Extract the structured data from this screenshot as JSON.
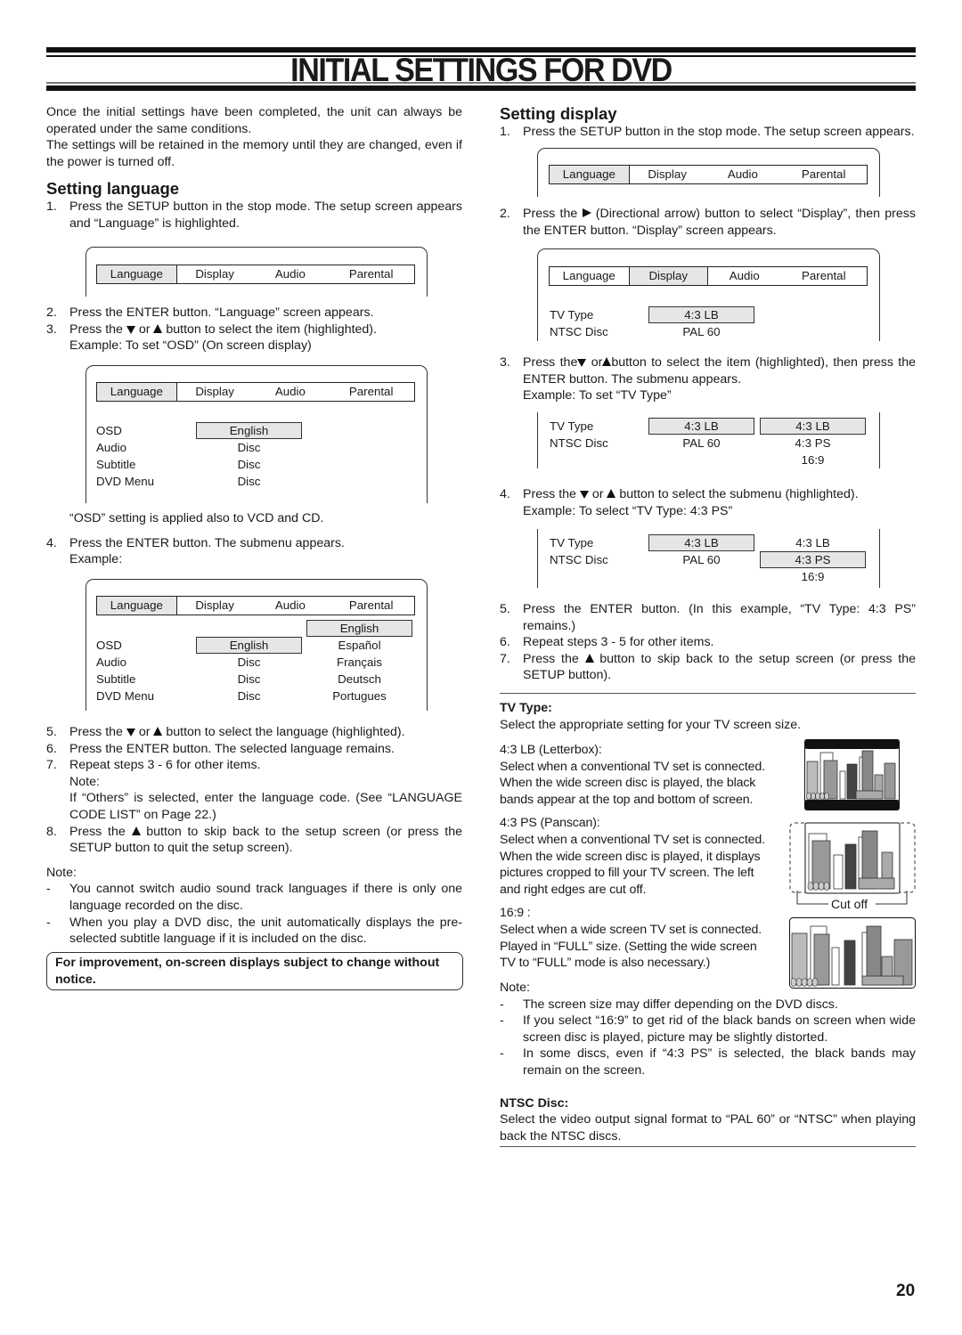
{
  "header": {
    "title": "INITIAL SETTINGS FOR DVD"
  },
  "left": {
    "intro": [
      "Once the initial settings have been completed, the unit can always be operated under the same conditions.",
      "The settings will be retained in the memory until they are changed, even if the power is turned off."
    ],
    "heading": "Setting language",
    "step1": {
      "num": "1.",
      "text": "Press the SETUP button in the stop mode. The setup screen appears and “Language” is highlighted."
    },
    "step2": {
      "num": "2.",
      "text": "Press the ENTER button. “Language” screen appears."
    },
    "step3": {
      "num": "3.",
      "pre": "Press the",
      "mid": "or",
      "post": "button to select the item (highlighted).",
      "example": "Example: To set “OSD” (On screen display)"
    },
    "osd_note": "“OSD” setting is applied also to VCD and CD.",
    "step4": {
      "num": "4.",
      "text": "Press the ENTER button. The submenu appears.",
      "example": "Example:"
    },
    "step5": {
      "num": "5.",
      "pre": "Press the",
      "mid": "or",
      "post": "button to select the language (highlighted)."
    },
    "step6": {
      "num": "6.",
      "text": "Press the ENTER button. The selected language remains."
    },
    "step7": {
      "num": "7.",
      "text": "Repeat steps 3 - 6 for other items.",
      "note_label": "Note:",
      "note_text": "If “Others” is selected, enter the language code. (See “LANGUAGE CODE LIST” on Page 22.)"
    },
    "step8": {
      "num": "8.",
      "pre": "Press the",
      "post": "button to skip back to the setup screen (or press the SETUP button to quit the setup screen)."
    },
    "note_label": "Note:",
    "notes": [
      "You cannot switch audio sound track languages if there is only one language recorded on the disc.",
      "When you play a DVD disc, the unit automatically displays the pre-selected subtitle language if it is included on the disc."
    ],
    "dash": "-",
    "improvement_notice": "For improvement, on-screen displays subject to change without notice."
  },
  "menu": {
    "tabs": [
      "Language",
      "Display",
      "Audio",
      "Parental"
    ],
    "language_items": [
      "OSD",
      "Audio",
      "Subtitle",
      "DVD Menu"
    ],
    "language_values": [
      "English",
      "Disc",
      "Disc",
      "Disc"
    ],
    "language_submenu": [
      "English",
      "Español",
      "Français",
      "Deutsch",
      "Portugues"
    ],
    "display_items": [
      "TV Type",
      "NTSC Disc"
    ],
    "display_values": [
      "4:3 LB",
      "PAL 60"
    ],
    "tv_type_submenu": [
      "4:3 LB",
      "4:3 PS",
      "16:9"
    ]
  },
  "right": {
    "heading": "Setting display",
    "step1": {
      "num": "1.",
      "text": "Press the SETUP button in the stop mode. The setup screen appears."
    },
    "step2": {
      "num": "2.",
      "pre": "Press the",
      "post": "(Directional arrow) button to select “Display”, then press the ENTER button. “Display” screen appears."
    },
    "step3": {
      "num": "3.",
      "pre": "Press the",
      "mid": "or",
      "post": "button to select the item (highlighted), then press the ENTER button. The submenu appears.",
      "example": "Example: To set “TV Type”"
    },
    "step4": {
      "num": "4.",
      "pre": "Press the",
      "mid": "or",
      "post": "button to select the submenu (highlighted).",
      "example": "Example: To select “TV Type: 4:3 PS”"
    },
    "step5": {
      "num": "5.",
      "text": "Press the ENTER button. (In this example, “TV Type: 4:3 PS” remains.)"
    },
    "step6": {
      "num": "6.",
      "text": "Repeat steps 3 - 5 for other items."
    },
    "step7": {
      "num": "7.",
      "pre": "Press the",
      "post": "button to skip back to the setup screen (or press the SETUP button)."
    },
    "tvtype": {
      "heading": "TV Type:",
      "intro": "Select the appropriate setting for your TV screen size.",
      "lb_label": "4:3 LB (Letterbox):",
      "lb_text": "Select when a conventional TV set is connected. When the wide screen disc is played, the black bands appear at the top and bottom of screen.",
      "ps_label": "4:3 PS (Panscan):",
      "ps_text": "Select when a conventional TV set is connected. When the wide screen disc is played, it displays pictures cropped to fill your TV screen. The left and right edges are cut off.",
      "wide_label": "16:9 :",
      "wide_text": "Select when a wide screen TV set is connected. Played in “FULL” size. (Setting the wide screen TV to “FULL” mode is also necessary.)",
      "cut_off": "Cut off"
    },
    "note_label": "Note:",
    "notes": [
      "The screen size may differ depending on the DVD discs.",
      "If you select “16:9” to get rid of the black bands on screen when wide screen disc is played, picture may be slightly distorted.",
      "In some discs, even if “4:3 PS” is selected, the black bands may remain on the screen."
    ],
    "dash": "-",
    "ntsc": {
      "heading": "NTSC Disc:",
      "text": "Select the video output signal format to “PAL 60” or “NTSC” when playing back the NTSC discs."
    }
  },
  "footer": {
    "page_number": "20"
  }
}
